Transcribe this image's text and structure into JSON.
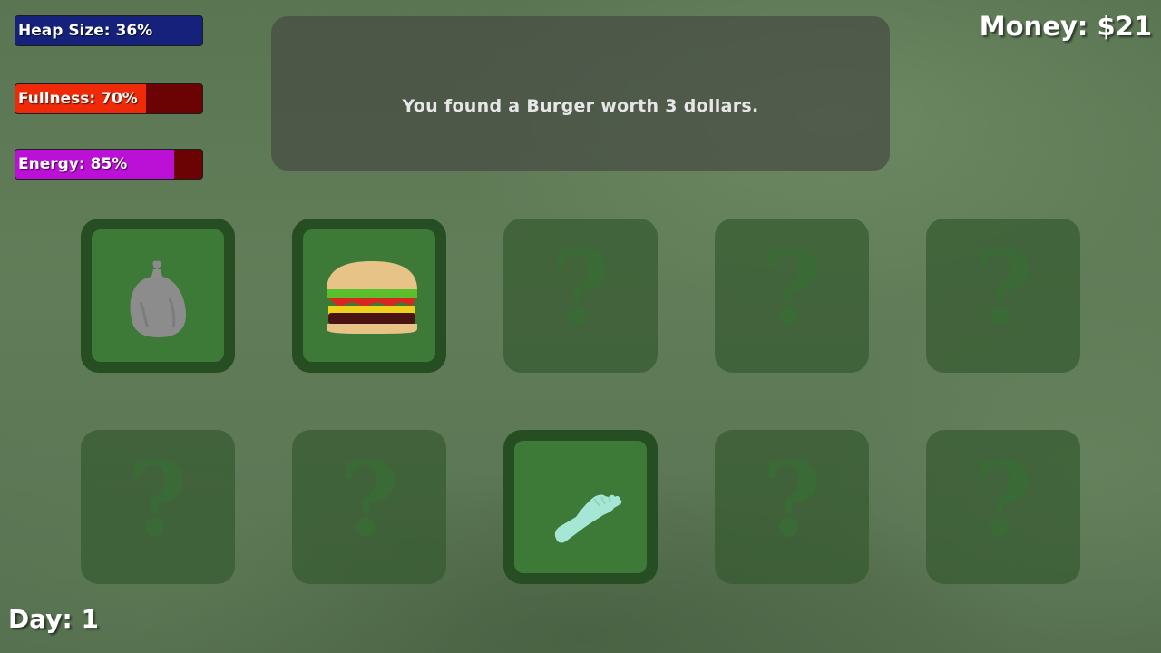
{
  "hud": {
    "heap": {
      "label": "Heap Size: 36%",
      "value": 0.36,
      "color": "#15217a"
    },
    "fullness": {
      "label": "Fullness: 70%",
      "value": 0.7,
      "color": "#ee2a08"
    },
    "energy": {
      "label": "Energy: 85%",
      "value": 0.85,
      "color": "#bb10d6"
    },
    "money": "Money: $21",
    "day": "Day: 1"
  },
  "message": "You found a Burger worth 3 dollars.",
  "cards": [
    {
      "state": "revealed",
      "item": "trash-bag"
    },
    {
      "state": "revealed",
      "item": "burger"
    },
    {
      "state": "hidden",
      "symbol": "?"
    },
    {
      "state": "hidden",
      "symbol": "?"
    },
    {
      "state": "hidden",
      "symbol": "?"
    },
    {
      "state": "hidden",
      "symbol": "?"
    },
    {
      "state": "hidden",
      "symbol": "?"
    },
    {
      "state": "revealed",
      "item": "glove"
    },
    {
      "state": "hidden",
      "symbol": "?"
    },
    {
      "state": "hidden",
      "symbol": "?"
    }
  ]
}
